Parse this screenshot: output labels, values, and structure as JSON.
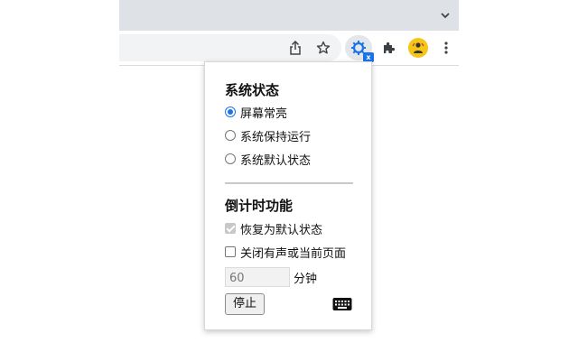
{
  "browser": {
    "toolbar_icons": [
      "share-icon",
      "bookmark-star-icon",
      "extension-active-icon",
      "puzzle-extensions-icon",
      "profile-avatar",
      "more-menu-icon"
    ],
    "extension_badge": "x",
    "colors": {
      "tabbar": "#dee1e6",
      "accent": "#1a73e8"
    }
  },
  "popup": {
    "system_state": {
      "title": "系统状态",
      "options": [
        {
          "label": "屏幕常亮",
          "checked": true
        },
        {
          "label": "系统保持运行",
          "checked": false
        },
        {
          "label": "系统默认状态",
          "checked": false
        }
      ]
    },
    "countdown": {
      "title": "倒计时功能",
      "restore_default": {
        "label": "恢复为默认状态",
        "checked": true,
        "disabled": true
      },
      "close_tab": {
        "label": "关闭有声或当前页面",
        "checked": false
      },
      "minutes_value": "60",
      "minutes_unit": "分钟",
      "stop_label": "停止",
      "shortcut_icon": "keyboard-icon"
    }
  }
}
